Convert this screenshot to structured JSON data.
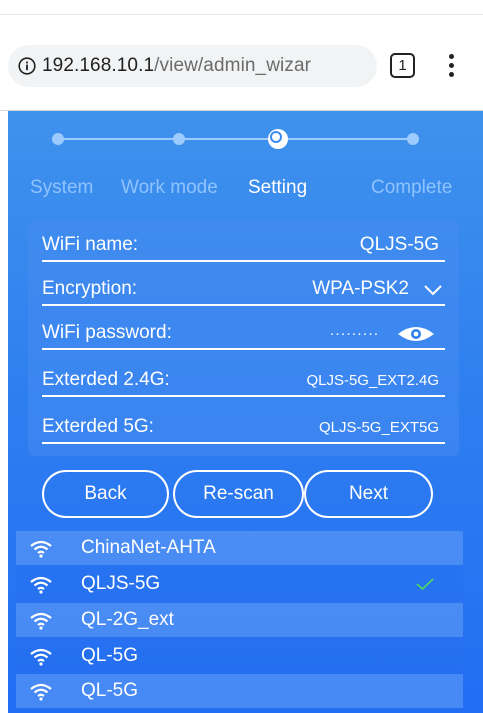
{
  "browser": {
    "url_host": "192.168.10.1",
    "url_path": "/view/admin_wizar",
    "tab_count": "1",
    "info_icon": "info-icon",
    "menu_icon": "more-vert-icon"
  },
  "stepper": {
    "steps": [
      "System",
      "Work mode",
      "Setting",
      "Complete"
    ],
    "current_step": 2
  },
  "form": {
    "wifi_name_label": "WiFi name:",
    "wifi_name_value": "QLJS-5G",
    "encryption_label": "Encryption:",
    "encryption_value": "WPA-PSK2",
    "password_label": "WiFi password:",
    "password_value": "·········",
    "ext24_label": "Exterded 2.4G:",
    "ext24_value": "QLJS-5G_EXT2.4G",
    "ext5_label": "Exterded 5G:",
    "ext5_value": "QLJS-5G_EXT5G"
  },
  "buttons": {
    "back": "Back",
    "rescan": "Re-scan",
    "next": "Next"
  },
  "networks": [
    {
      "ssid": "ChinaNet-AHTA",
      "selected": false
    },
    {
      "ssid": "QLJS-5G",
      "selected": true
    },
    {
      "ssid": "QL-2G_ext",
      "selected": false
    },
    {
      "ssid": "QL-5G",
      "selected": false
    },
    {
      "ssid": "QL-5G",
      "selected": false
    }
  ],
  "colors": {
    "accent": "#2f7ff0",
    "step_inactive": "#8fc3ff",
    "check": "#4cd964"
  }
}
